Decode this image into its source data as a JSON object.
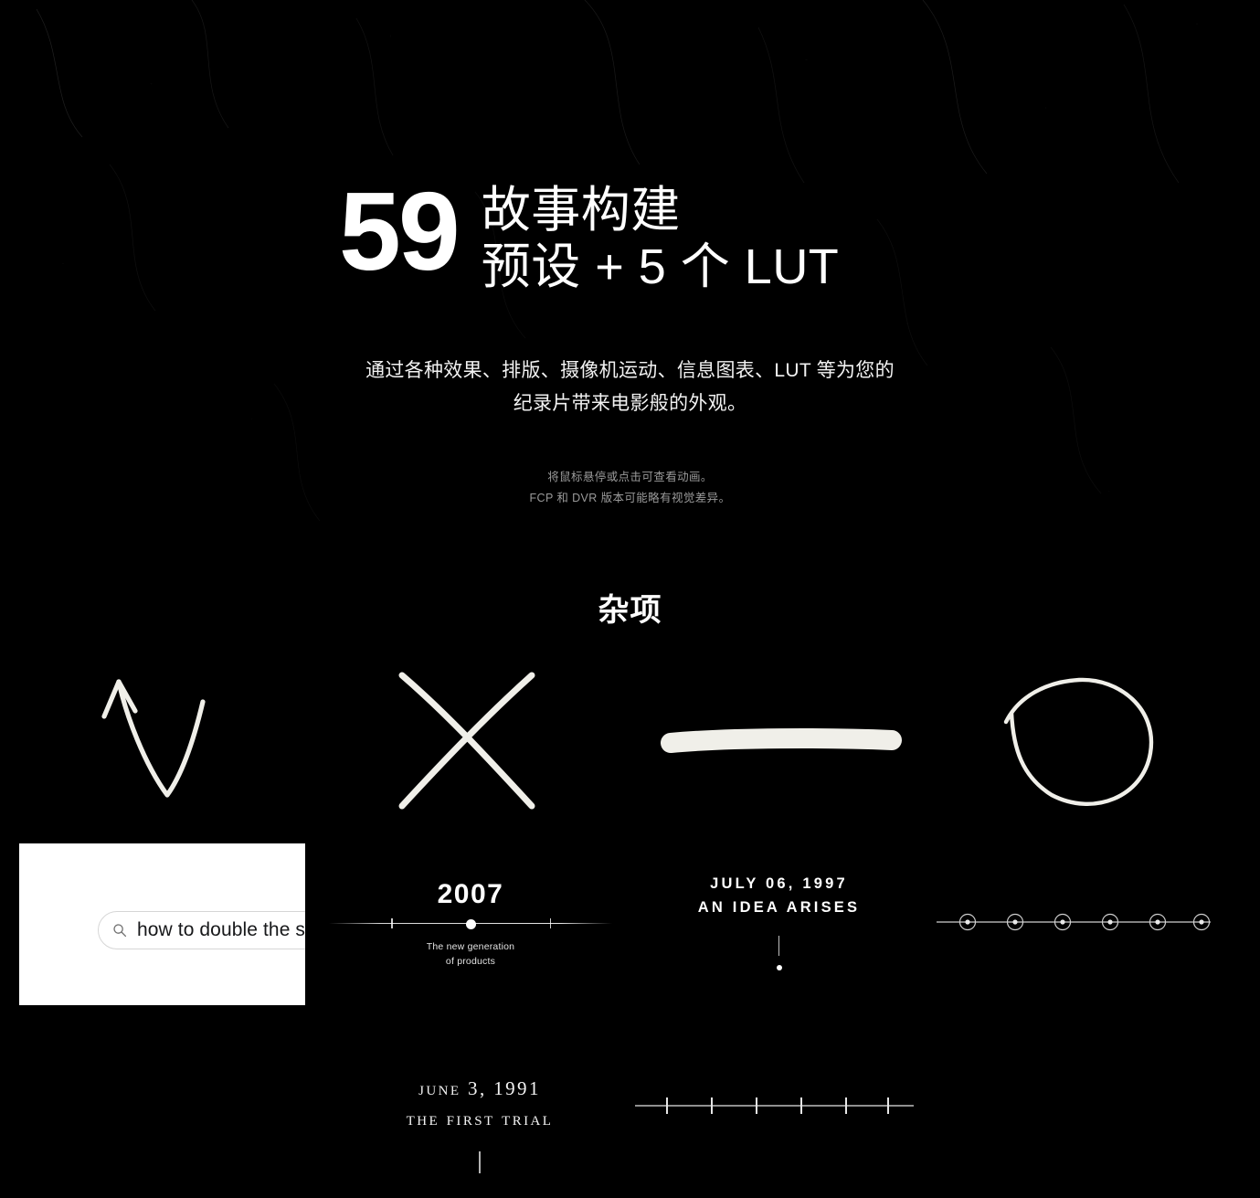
{
  "hero": {
    "big_number": "59",
    "headline_line1": "故事构建",
    "headline_line2": "预设 + 5 个 LUT",
    "subcopy_line1": "通过各种效果、排版、摄像机运动、信息图表、LUT 等为您的",
    "subcopy_line2": "纪录片带来电影般的外观。",
    "note_line1": "将鼠标悬停或点击可查看动画。",
    "note_line2": "FCP 和 DVR 版本可能略有视觉差异。"
  },
  "section": {
    "title": "杂项"
  },
  "doodles": [
    {
      "name": "hand-drawn-up-arrow",
      "color": "#f0efe9"
    },
    {
      "name": "hand-drawn-cross",
      "color": "#f0efe9"
    },
    {
      "name": "hand-drawn-highlight-bar",
      "color": "#ccf700"
    },
    {
      "name": "hand-drawn-circle",
      "color": "#f0efe9"
    }
  ],
  "search_card": {
    "query_text": "how to double the sale",
    "icon": "search-icon",
    "background": "#ffffff",
    "text_color": "#17181a"
  },
  "timeline_2007": {
    "year": "2007",
    "caption_line1": "The new generation",
    "caption_line2": "of products"
  },
  "timeline_1997": {
    "date": "JULY 06, 1997",
    "event": "AN IDEA ARISES"
  },
  "node_rail": {
    "node_count": 6
  },
  "timeline_1991": {
    "date": "June 3, 1991",
    "event": "The first trial"
  },
  "ruler": {
    "tick_count": 6
  },
  "theme": {
    "background": "#000000",
    "foreground": "#ffffff",
    "accent": "#ccf700",
    "muted": "#9a9a9a"
  }
}
